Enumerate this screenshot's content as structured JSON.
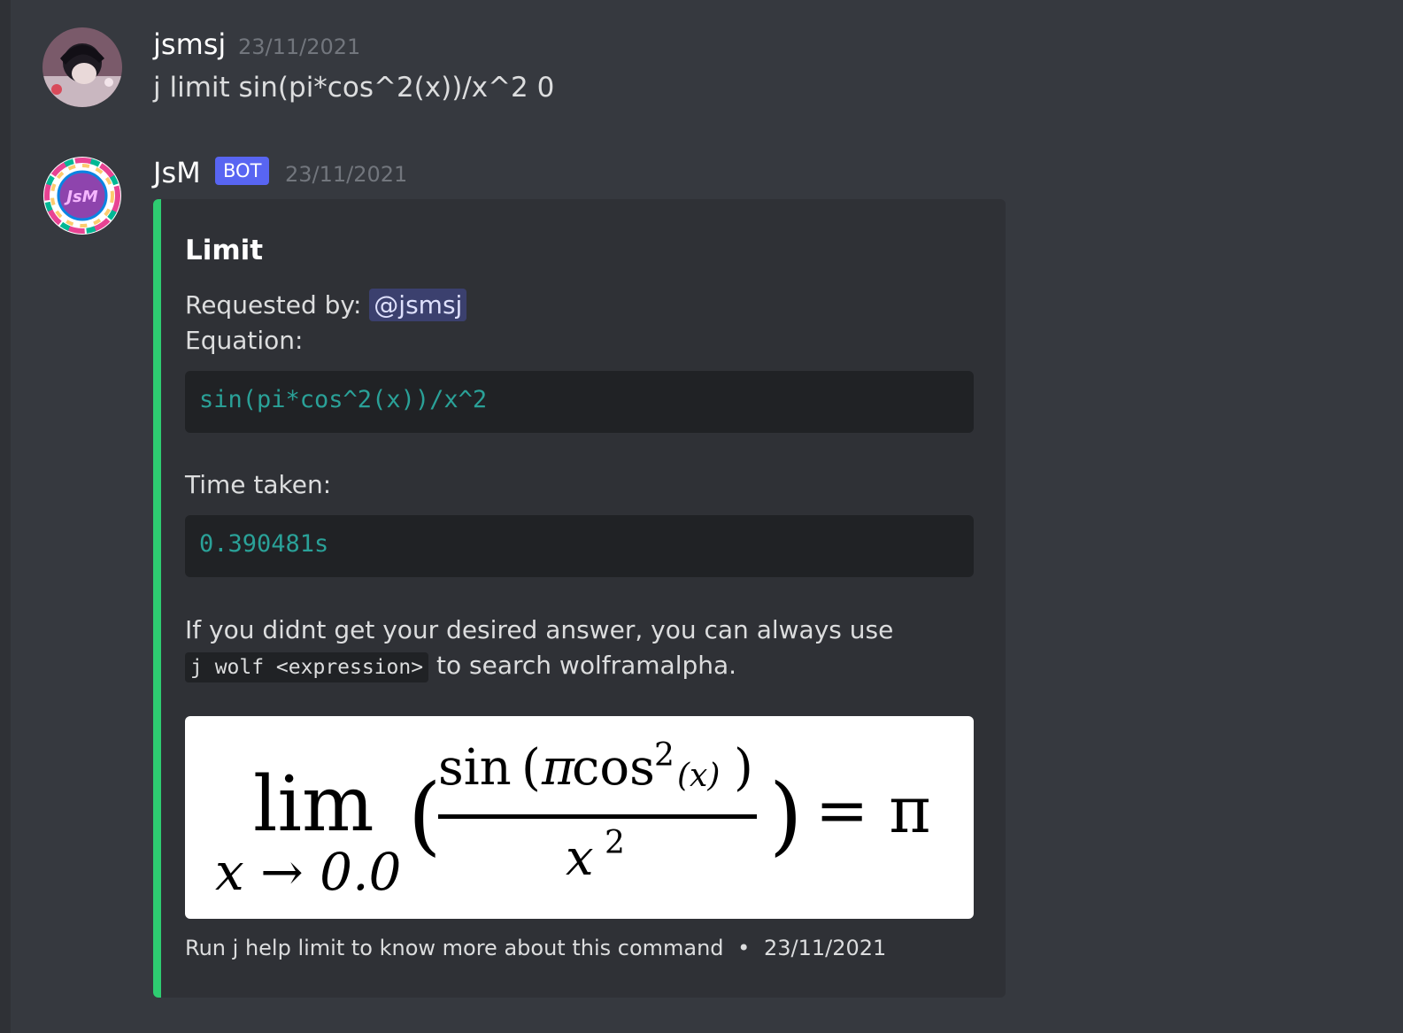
{
  "messages": [
    {
      "username": "jsmsj",
      "timestamp": "23/11/2021",
      "content": "j limit sin(pi*cos^2(x))/x^2 0"
    },
    {
      "username": "JsM",
      "bot_tag": "BOT",
      "timestamp": "23/11/2021",
      "avatar_text": "JsM",
      "embed": {
        "accent_color": "#2ecc71",
        "title": "Limit",
        "requested_by_label": "Requested by:",
        "mention": "@jsmsj",
        "equation_label": "Equation:",
        "equation_code": "sin(pi*cos^2(x))/x^2",
        "time_label": "Time taken:",
        "time_code": "0.390481s",
        "hint_line1": "If you didnt get your desired answer, you can always use",
        "hint_code": "j wolf <expression>",
        "hint_line2": "to search wolframalpha.",
        "image": {
          "lim": "lim",
          "subscript": "x → 0.0",
          "numerator_sin": "sin",
          "numerator_pi": "π",
          "numerator_cos": "cos",
          "numerator_exp": "2",
          "numerator_arg": "(x)",
          "denominator_x": "x",
          "denominator_exp": "2",
          "result": "= π"
        },
        "footer_text": "Run j help limit to know more about this command",
        "footer_separator": "•",
        "footer_date": "23/11/2021"
      }
    }
  ]
}
